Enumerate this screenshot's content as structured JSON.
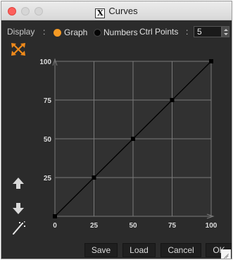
{
  "window": {
    "title": "Curves",
    "title_icon": "x-logo-icon"
  },
  "display": {
    "label": "Display",
    "separator": ":",
    "options": [
      {
        "label": "Graph",
        "selected": true
      },
      {
        "label": "Numbers",
        "selected": false
      }
    ],
    "ctrl_points_label": "Ctrl Points",
    "ctrl_points_separator": ":",
    "ctrl_points_value": "5"
  },
  "tools": [
    {
      "name": "reset-curve-tool",
      "icon": "orange-cross-arrows-icon"
    },
    {
      "name": "move-up-tool",
      "icon": "arrow-up-icon"
    },
    {
      "name": "move-down-tool",
      "icon": "arrow-down-icon"
    },
    {
      "name": "magic-wand-tool",
      "icon": "magic-wand-icon"
    }
  ],
  "graph": {
    "x_ticks": [
      "0",
      "25",
      "50",
      "75",
      "100"
    ],
    "y_ticks": [
      "100",
      "75",
      "50",
      "25"
    ],
    "control_points": [
      {
        "x": 0,
        "y": 0
      },
      {
        "x": 25,
        "y": 25
      },
      {
        "x": 50,
        "y": 50
      },
      {
        "x": 75,
        "y": 75
      },
      {
        "x": 100,
        "y": 100
      }
    ],
    "range": [
      0,
      100
    ]
  },
  "buttons": {
    "save": "Save",
    "load": "Load",
    "cancel": "Cancel",
    "ok": "OK"
  },
  "colors": {
    "window_bg": "#2b2b2b",
    "plot_bg": "#313131",
    "grid": "#7a7a7a",
    "accent": "#f59a24",
    "curve": "#000000"
  }
}
